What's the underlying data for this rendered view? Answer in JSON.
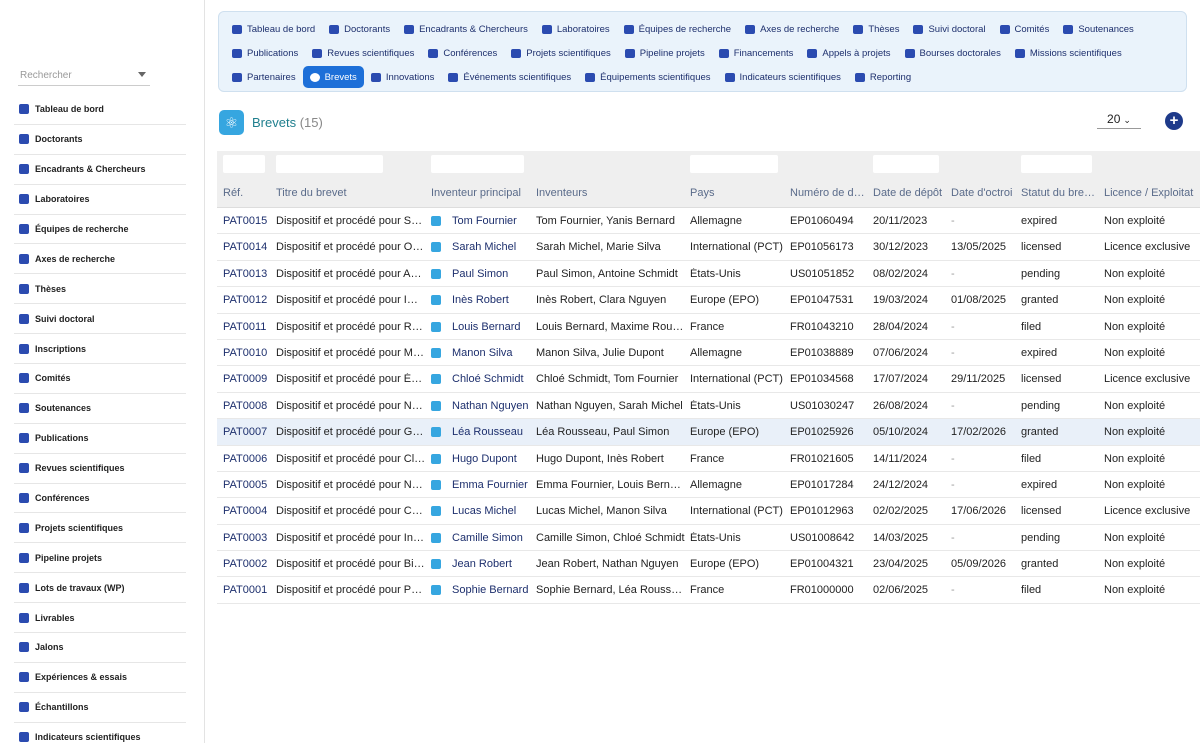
{
  "sidebar": {
    "search_placeholder": "Rechercher",
    "items": [
      {
        "label": "Tableau de bord",
        "icon": "dashboard-icon"
      },
      {
        "label": "Doctorants",
        "icon": "graduate-icon"
      },
      {
        "label": "Encadrants & Chercheurs",
        "icon": "teacher-icon"
      },
      {
        "label": "Laboratoires",
        "icon": "flask-icon"
      },
      {
        "label": "Équipes de recherche",
        "icon": "users-icon"
      },
      {
        "label": "Axes de recherche",
        "icon": "sitemap-icon"
      },
      {
        "label": "Thèses",
        "icon": "book-icon"
      },
      {
        "label": "Suivi doctoral",
        "icon": "clipboard-icon"
      },
      {
        "label": "Inscriptions",
        "icon": "id-card-icon"
      },
      {
        "label": "Comités",
        "icon": "users-icon"
      },
      {
        "label": "Soutenances",
        "icon": "presenter-icon"
      },
      {
        "label": "Publications",
        "icon": "open-book-icon"
      },
      {
        "label": "Revues scientifiques",
        "icon": "newspaper-icon"
      },
      {
        "label": "Conférences",
        "icon": "chalkboard-icon"
      },
      {
        "label": "Projets scientifiques",
        "icon": "project-diagram-icon"
      },
      {
        "label": "Pipeline projets",
        "icon": "list-icon"
      },
      {
        "label": "Lots de travaux (WP)",
        "icon": "tasks-icon"
      },
      {
        "label": "Livrables",
        "icon": "clipboard-check-icon"
      },
      {
        "label": "Jalons",
        "icon": "flag-icon"
      },
      {
        "label": "Expériences & essais",
        "icon": "pen-icon"
      },
      {
        "label": "Échantillons",
        "icon": "vial-icon"
      },
      {
        "label": "Indicateurs scientifiques",
        "icon": "chart-line-icon"
      }
    ]
  },
  "topmenu": {
    "rows": [
      [
        {
          "label": "Tableau de bord",
          "icon": "dashboard-icon"
        },
        {
          "label": "Doctorants",
          "icon": "graduate-icon"
        },
        {
          "label": "Encadrants & Chercheurs",
          "icon": "teacher-icon"
        },
        {
          "label": "Laboratoires",
          "icon": "flask-icon"
        },
        {
          "label": "Équipes de recherche",
          "icon": "users-icon"
        },
        {
          "label": "Axes de recherche",
          "icon": "sitemap-icon"
        },
        {
          "label": "Thèses",
          "icon": "book-icon"
        },
        {
          "label": "Suivi doctoral",
          "icon": "clipboard-icon"
        },
        {
          "label": "Comités",
          "icon": "users-icon"
        },
        {
          "label": "Soutenances",
          "icon": "presenter-icon"
        }
      ],
      [
        {
          "label": "Publications",
          "icon": "open-book-icon"
        },
        {
          "label": "Revues scientifiques",
          "icon": "newspaper-icon"
        },
        {
          "label": "Conférences",
          "icon": "chalkboard-icon"
        },
        {
          "label": "Projets scientifiques",
          "icon": "project-diagram-icon"
        },
        {
          "label": "Pipeline projets",
          "icon": "list-icon"
        },
        {
          "label": "Financements",
          "icon": "money-icon"
        },
        {
          "label": "Appels à projets",
          "icon": "bullhorn-icon"
        },
        {
          "label": "Bourses doctorales",
          "icon": "hand-coin-icon"
        },
        {
          "label": "Missions scientifiques",
          "icon": "plane-icon"
        }
      ],
      [
        {
          "label": "Partenaires",
          "icon": "building-icon"
        },
        {
          "label": "Brevets",
          "icon": "atom-icon",
          "active": true
        },
        {
          "label": "Innovations",
          "icon": "lightbulb-icon"
        },
        {
          "label": "Événements scientifiques",
          "icon": "calendar-icon"
        },
        {
          "label": "Équipements scientifiques",
          "icon": "microscope-icon"
        },
        {
          "label": "Indicateurs scientifiques",
          "icon": "chart-line-icon"
        },
        {
          "label": "Reporting",
          "icon": "chart-pie-icon"
        }
      ]
    ]
  },
  "header": {
    "title": "Brevets",
    "count": "(15)",
    "logo_icon": "atom-icon",
    "page_size": "20",
    "add_icon": "plus-icon"
  },
  "table": {
    "columns": [
      "Réf.",
      "Titre du brevet",
      "Inventeur principal",
      "Inventeurs",
      "Pays",
      "Numéro de d…",
      "Date de dépôt",
      "Date d'octroi",
      "Statut du bre…",
      "Licence / Exploitat"
    ],
    "rows": [
      [
        "PAT0015",
        "Dispositif et procédé pour S…",
        "Tom Fournier",
        "Tom Fournier, Yanis Bernard",
        "Allemagne",
        "EP01060494",
        "20/11/2023",
        "-",
        "expired",
        "Non exploité"
      ],
      [
        "PAT0014",
        "Dispositif et procédé pour O…",
        "Sarah Michel",
        "Sarah Michel, Marie Silva",
        "International (PCT)",
        "EP01056173",
        "30/12/2023",
        "13/05/2025",
        "licensed",
        "Licence exclusive"
      ],
      [
        "PAT0013",
        "Dispositif et procédé pour A…",
        "Paul Simon",
        "Paul Simon, Antoine Schmidt",
        "États-Unis",
        "US01051852",
        "08/02/2024",
        "-",
        "pending",
        "Non exploité"
      ],
      [
        "PAT0012",
        "Dispositif et procédé pour I…",
        "Inès Robert",
        "Inès Robert, Clara Nguyen",
        "Europe (EPO)",
        "EP01047531",
        "19/03/2024",
        "01/08/2025",
        "granted",
        "Non exploité"
      ],
      [
        "PAT0011",
        "Dispositif et procédé pour R…",
        "Louis Bernard",
        "Louis Bernard, Maxime Rou…",
        "France",
        "FR01043210",
        "28/04/2024",
        "-",
        "filed",
        "Non exploité"
      ],
      [
        "PAT0010",
        "Dispositif et procédé pour M…",
        "Manon Silva",
        "Manon Silva, Julie Dupont",
        "Allemagne",
        "EP01038889",
        "07/06/2024",
        "-",
        "expired",
        "Non exploité"
      ],
      [
        "PAT0009",
        "Dispositif et procédé pour É…",
        "Chloé Schmidt",
        "Chloé Schmidt, Tom Fournier",
        "International (PCT)",
        "EP01034568",
        "17/07/2024",
        "29/11/2025",
        "licensed",
        "Licence exclusive"
      ],
      [
        "PAT0008",
        "Dispositif et procédé pour N…",
        "Nathan Nguyen",
        "Nathan Nguyen, Sarah Michel",
        "États-Unis",
        "US01030247",
        "26/08/2024",
        "-",
        "pending",
        "Non exploité"
      ],
      [
        "PAT0007",
        "Dispositif et procédé pour G…",
        "Léa Rousseau",
        "Léa Rousseau, Paul Simon",
        "Europe (EPO)",
        "EP01025926",
        "05/10/2024",
        "17/02/2026",
        "granted",
        "Non exploité"
      ],
      [
        "PAT0006",
        "Dispositif et procédé pour Cl…",
        "Hugo Dupont",
        "Hugo Dupont, Inès Robert",
        "France",
        "FR01021605",
        "14/11/2024",
        "-",
        "filed",
        "Non exploité"
      ],
      [
        "PAT0005",
        "Dispositif et procédé pour N…",
        "Emma Fournier",
        "Emma Fournier, Louis Bern…",
        "Allemagne",
        "EP01017284",
        "24/12/2024",
        "-",
        "expired",
        "Non exploité"
      ],
      [
        "PAT0004",
        "Dispositif et procédé pour C…",
        "Lucas Michel",
        "Lucas Michel, Manon Silva",
        "International (PCT)",
        "EP01012963",
        "02/02/2025",
        "17/06/2026",
        "licensed",
        "Licence exclusive"
      ],
      [
        "PAT0003",
        "Dispositif et procédé pour In…",
        "Camille Simon",
        "Camille Simon, Chloé Schmidt",
        "États-Unis",
        "US01008642",
        "14/03/2025",
        "-",
        "pending",
        "Non exploité"
      ],
      [
        "PAT0002",
        "Dispositif et procédé pour Bi…",
        "Jean Robert",
        "Jean Robert, Nathan Nguyen",
        "Europe (EPO)",
        "EP01004321",
        "23/04/2025",
        "05/09/2026",
        "granted",
        "Non exploité"
      ],
      [
        "PAT0001",
        "Dispositif et procédé pour P…",
        "Sophie Bernard",
        "Sophie Bernard, Léa Rouss…",
        "France",
        "FR01000000",
        "02/06/2025",
        "-",
        "filed",
        "Non exploité"
      ]
    ],
    "highlighted_row": 8
  },
  "colors": {
    "accent": "#1d6fd8",
    "nav_text": "#1d2f6d",
    "title_teal": "#1f7f8e",
    "menu_bg": "#eaf3fb"
  }
}
